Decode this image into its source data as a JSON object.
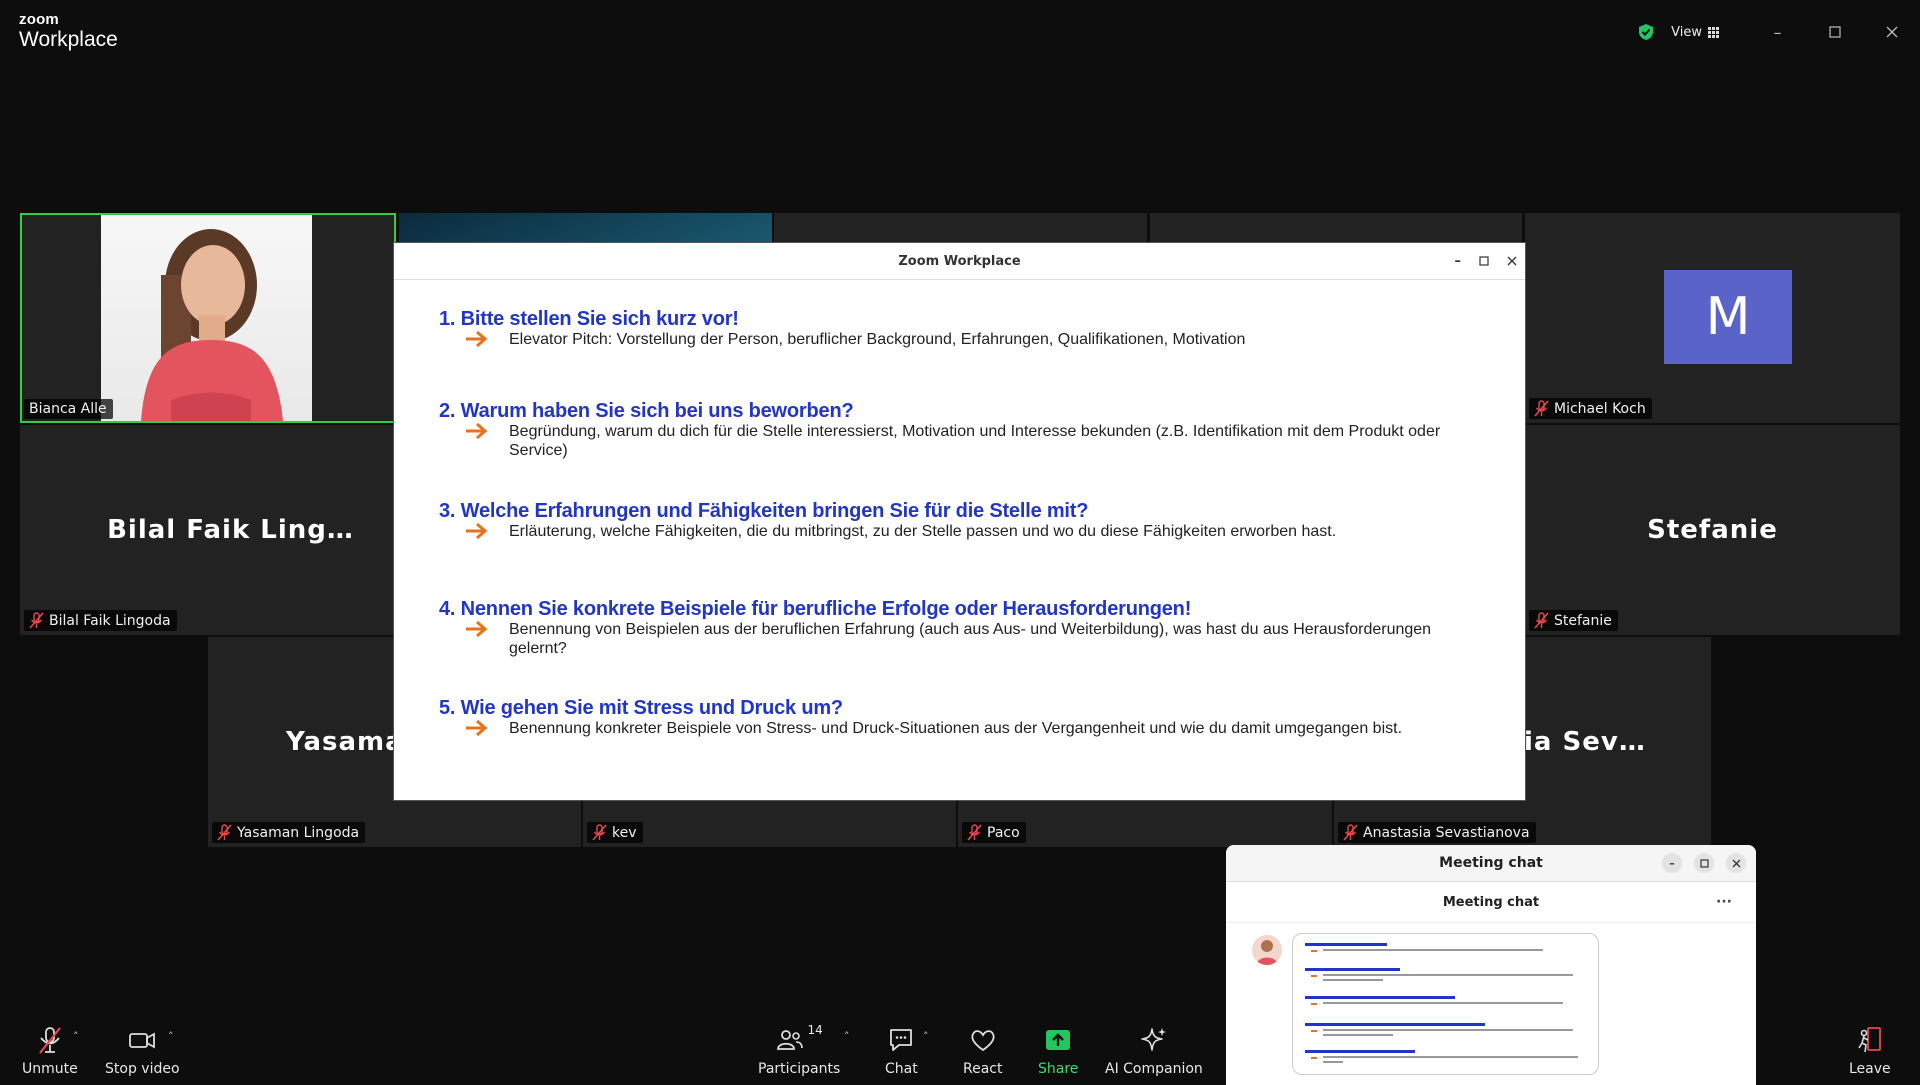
{
  "app": {
    "brand_small": "zoom",
    "brand_big": "Workplace",
    "view_label": "View"
  },
  "participants": {
    "bianca": "Bianca Alle",
    "michael": "Michael Koch",
    "bilal_big": "Bilal Faik Ling…",
    "bilal": "Bilal Faik Lingoda",
    "stefanie_big": "Stefanie",
    "stefanie": "Stefanie",
    "yasaman_big": "Yasama",
    "yasaman": "Yasaman Lingoda",
    "kev": "kev",
    "paco": "Paco",
    "anastasia_big": "ia Sev…",
    "anastasia": "Anastasia Sevastianova",
    "michael_avatar": "M"
  },
  "share": {
    "window_title": "Zoom Workplace",
    "questions": [
      {
        "title": "1. Bitte stellen Sie sich kurz vor!",
        "body": "Elevator Pitch: Vorstellung der Person, beruflicher Background, Erfahrungen, Qualifikationen, Motivation"
      },
      {
        "title": "2. Warum haben Sie sich bei uns beworben?",
        "body": "Begründung, warum du dich für die Stelle interessierst, Motivation und Interesse bekunden (z.B. Identifikation mit dem Produkt oder Service)"
      },
      {
        "title": "3. Welche Erfahrungen  und Fähigkeiten bringen Sie für die Stelle mit?",
        "body": "Erläuterung, welche Fähigkeiten, die du mitbringst, zu der Stelle passen und wo du diese Fähigkeiten erworben hast."
      },
      {
        "title": "4. Nennen Sie konkrete Beispiele für berufliche Erfolge oder Herausforderungen!",
        "body": "Benennung von Beispielen aus der beruflichen Erfahrung (auch aus Aus- und Weiterbildung), was hast du aus Herausforderungen gelernt?"
      },
      {
        "title": "5. Wie gehen Sie mit Stress und Druck um?",
        "body": "Benennung konkreter Beispiele von Stress- und Druck-Situationen aus der Vergangenheit und wie du damit umgegangen bist."
      }
    ]
  },
  "chat": {
    "window_title": "Meeting chat",
    "header": "Meeting chat",
    "more": "···"
  },
  "toolbar": {
    "unmute": "Unmute",
    "stop_video": "Stop video",
    "participants": "Participants",
    "participants_count": "14",
    "chat": "Chat",
    "react": "React",
    "share": "Share",
    "ai_companion": "AI Companion",
    "leave": "Leave"
  },
  "colors": {
    "accent_green": "#2ecf47",
    "share_green": "#22c55e",
    "title_blue": "#2236c5",
    "arrow_orange": "#e8721c",
    "avatar_purple": "#5963c8",
    "leave_red": "#e5484d"
  }
}
